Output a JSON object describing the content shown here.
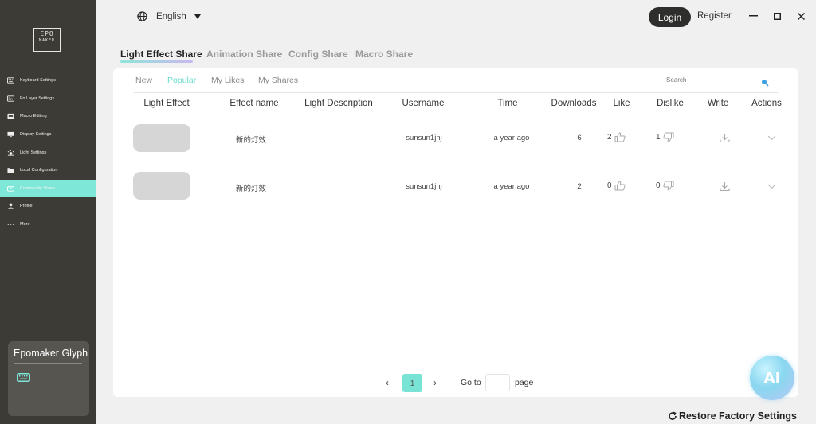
{
  "sidebar": {
    "logo_line1": "EPO",
    "logo_line2": "MAKER",
    "logo_letter": "M",
    "items": [
      {
        "label": "Keyboard Settings",
        "icon": "keyboard-icon"
      },
      {
        "label": "Fn Layer Settings",
        "icon": "fn-layer-icon"
      },
      {
        "label": "Macro Editing",
        "icon": "macro-icon"
      },
      {
        "label": "Display Settings",
        "icon": "display-icon"
      },
      {
        "label": "Light Settings",
        "icon": "light-icon"
      },
      {
        "label": "Local Configuration",
        "icon": "folder-icon"
      },
      {
        "label": "Community Share",
        "icon": "cloud-icon",
        "active": true
      },
      {
        "label": "Profile",
        "icon": "user-icon"
      },
      {
        "label": "More",
        "icon": "more-icon"
      }
    ],
    "device_name": "Epomaker Glyph",
    "active_color": "#7ee7d8"
  },
  "topbar": {
    "language": "English",
    "login_label": "Login",
    "register_label": "Register"
  },
  "tabs": [
    "Light Effect Share",
    "Animation Share",
    "Config Share",
    "Macro Share"
  ],
  "subtabs": [
    "New",
    "Popular",
    "My Likes",
    "My Shares"
  ],
  "active_subtab": "Popular",
  "search": {
    "placeholder": "Search"
  },
  "table": {
    "columns": [
      "Light Effect",
      "Effect name",
      "Light Description",
      "Username",
      "Time",
      "Downloads",
      "Like",
      "Dislike",
      "Write",
      "Actions"
    ],
    "rows": [
      {
        "effect_name": "新的灯效",
        "description": "",
        "username": "sunsun1jnj",
        "time": "a year ago",
        "downloads": "6",
        "likes": "2",
        "dislikes": "1"
      },
      {
        "effect_name": "新的灯效",
        "description": "",
        "username": "sunsun1jnj",
        "time": "a year ago",
        "downloads": "2",
        "likes": "0",
        "dislikes": "0"
      }
    ]
  },
  "pagination": {
    "prev": "‹",
    "next": "›",
    "current_page": "1",
    "goto_label": "Go to",
    "page_label": "page"
  },
  "ai_button": "AI",
  "restore_label": "Restore Factory Settings",
  "colors": {
    "accent": "#79e4d5",
    "sidebar_bg": "#3c3b35",
    "login_bg": "#2e2e2c"
  }
}
